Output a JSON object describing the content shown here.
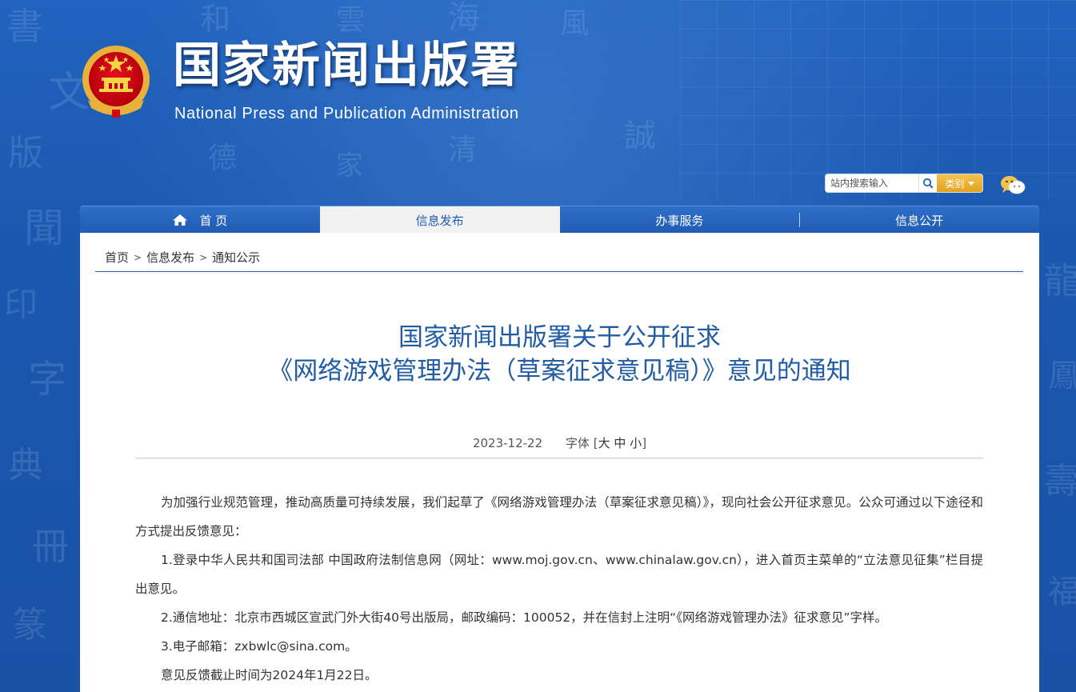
{
  "header": {
    "site_title": "国家新闻出版署",
    "site_subtitle": "National  Press and Publication Administration",
    "emblem_icon": "national-emblem",
    "search_placeholder": "站内搜索输入",
    "category_label": "类别",
    "wechat_icon": "wechat-icon"
  },
  "nav": {
    "items": [
      {
        "label": "首 页",
        "icon": "home-icon"
      },
      {
        "label": "信息发布"
      },
      {
        "label": "办事服务"
      },
      {
        "label": "信息公开"
      }
    ],
    "active_index": 1
  },
  "breadcrumb": {
    "items": [
      "首页",
      "信息发布",
      "通知公示"
    ],
    "separator": ">"
  },
  "article": {
    "title_line1": "国家新闻出版署关于公开征求",
    "title_line2": "《网络游戏管理办法（草案征求意见稿）》意见的通知",
    "date": "2023-12-22",
    "font_size_label": "字体",
    "font_sizes": [
      "大",
      "中",
      "小"
    ],
    "paragraphs": [
      "为加强行业规范管理，推动高质量可持续发展，我们起草了《网络游戏管理办法（草案征求意见稿）》，现向社会公开征求意见。公众可通过以下途径和方式提出反馈意见：",
      "1.登录中华人民共和国司法部 中国政府法制信息网（网址：www.moj.gov.cn、www.chinalaw.gov.cn），进入首页主菜单的“立法意见征集”栏目提出意见。",
      "2.通信地址：北京市西城区宣武门外大街40号出版局，邮政编码：100052，并在信封上注明“《网络游戏管理办法》征求意见”字样。",
      "3.电子邮箱：zxbwlc@sina.com。",
      "意见反馈截止时间为2024年1月22日。"
    ]
  },
  "colors": {
    "header_blue": "#1b58b0",
    "nav_blue": "#1f5cb4",
    "title_blue": "#215ca4",
    "accent_gold": "#e4a21e",
    "emblem_red": "#d7000f"
  }
}
